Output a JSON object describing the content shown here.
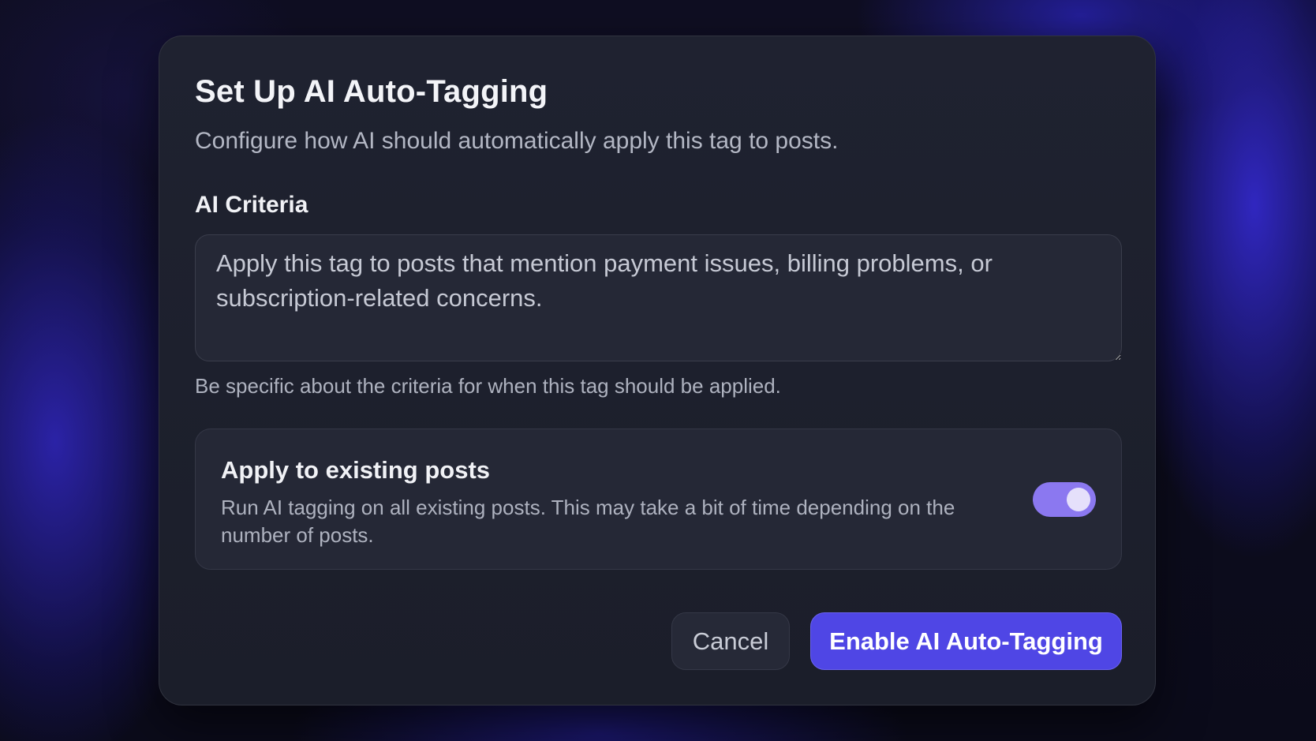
{
  "dialog": {
    "title": "Set Up AI Auto-Tagging",
    "subtitle": "Configure how AI should automatically apply this tag to posts."
  },
  "criteria": {
    "label": "AI Criteria",
    "value": "Apply this tag to posts that mention payment issues, billing problems, or subscription-related concerns.",
    "hint": "Be specific about the criteria for when this tag should be applied."
  },
  "existing_posts": {
    "title": "Apply to existing posts",
    "description": "Run AI tagging on all existing posts. This may take a bit of time depending on the number of posts.",
    "toggle_on": true
  },
  "actions": {
    "cancel_label": "Cancel",
    "enable_label": "Enable AI Auto-Tagging"
  },
  "colors": {
    "primary": "#4f46e5",
    "toggle_on": "#8b78f0",
    "modal_bg": "#1f2230"
  }
}
